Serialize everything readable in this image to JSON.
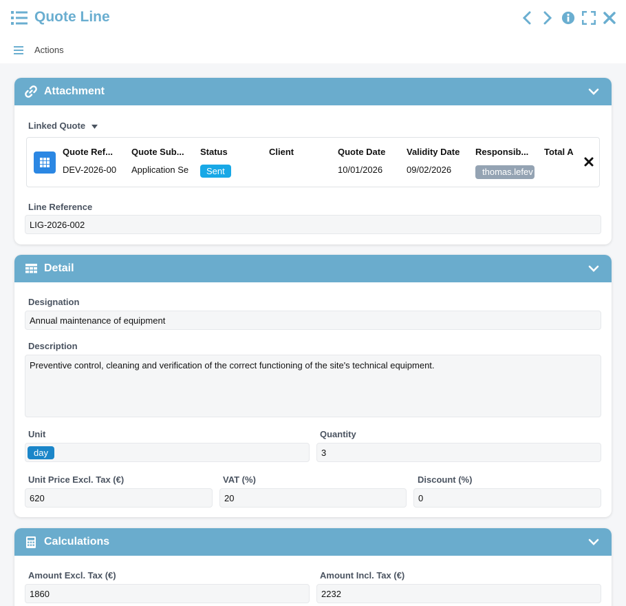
{
  "window": {
    "title": "Quote Line",
    "actions_label": "Actions"
  },
  "attachment": {
    "heading": "Attachment",
    "linked_quote_label": "Linked Quote",
    "columns": [
      "Quote Ref...",
      "Quote Sub...",
      "Status",
      "Client",
      "Quote Date",
      "Validity Date",
      "Responsib...",
      "Total A"
    ],
    "row": {
      "ref": "DEV-2026-00",
      "subject": "Application Se",
      "status": "Sent",
      "client": "",
      "quote_date": "10/01/2026",
      "validity_date": "09/02/2026",
      "responsible": "thomas.lefev"
    },
    "line_ref_label": "Line Reference",
    "line_ref_value": "LIG-2026-002"
  },
  "detail": {
    "heading": "Detail",
    "designation_label": "Designation",
    "designation_value": "Annual maintenance of equipment",
    "description_label": "Description",
    "description_value": "Preventive control, cleaning and verification of the correct functioning of the site's technical equipment.",
    "unit_label": "Unit",
    "unit_value": "day",
    "quantity_label": "Quantity",
    "quantity_value": "3",
    "unit_price_label": "Unit Price Excl. Tax (€)",
    "unit_price_value": "620",
    "vat_label": "VAT (%)",
    "vat_value": "20",
    "discount_label": "Discount (%)",
    "discount_value": "0"
  },
  "calculations": {
    "heading": "Calculations",
    "amount_excl_label": "Amount Excl. Tax (€)",
    "amount_excl_value": "1860",
    "amount_incl_label": "Amount Incl. Tax (€)",
    "amount_incl_value": "2232"
  },
  "colors": {
    "accent": "#6aaed0",
    "header_bar": "#6aaccd",
    "status_sent": "#18a8e6",
    "grid_button": "#2b87e3"
  },
  "icons": [
    "list-icon",
    "chevron-left-icon",
    "chevron-right-icon",
    "info-icon",
    "fullscreen-icon",
    "close-icon",
    "hamburger-icon",
    "link-icon",
    "table-icon",
    "calculator-icon",
    "chevron-down-icon",
    "caret-down-icon",
    "remove-icon"
  ]
}
